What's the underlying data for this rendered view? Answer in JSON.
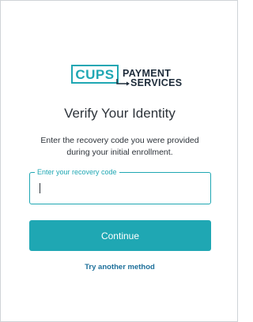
{
  "logo": {
    "mark_text": "CUPS",
    "line1": "PAYMENT",
    "line2": "SERVICES",
    "brand_color": "#1fa7b3",
    "text_color": "#1d2b3a"
  },
  "page": {
    "title": "Verify Your Identity",
    "description": "Enter the recovery code you were provided during your initial enrollment."
  },
  "recovery_field": {
    "label": "Enter your recovery code",
    "value": ""
  },
  "actions": {
    "continue_label": "Continue",
    "alternate_label": "Try another method"
  },
  "colors": {
    "accent": "#1fa7b3",
    "link": "#1d6f9a",
    "text": "#2d333a",
    "border": "#cfd3d7"
  }
}
